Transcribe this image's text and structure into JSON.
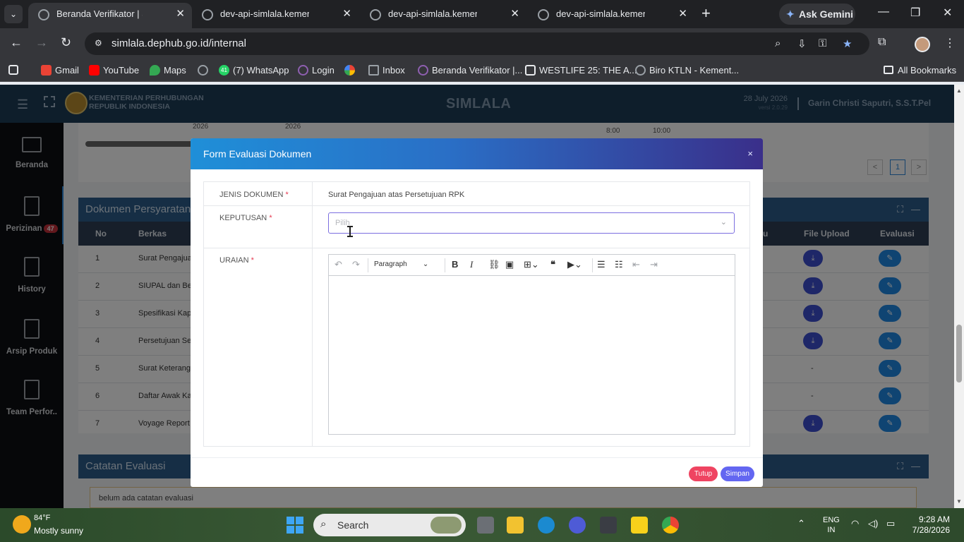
{
  "browser": {
    "tabs": [
      {
        "label": "Beranda Verifikator | SimLala",
        "active": true
      },
      {
        "label": "dev-api-simlala.kemenhub.go.id",
        "active": false
      },
      {
        "label": "dev-api-simlala.kemenhub.go.id",
        "active": false
      },
      {
        "label": "dev-api-simlala.kemenhub.go.id",
        "active": false
      }
    ],
    "gemini_label": "Ask Gemini",
    "url": "simlala.dephub.go.id/internal",
    "bookmarks": [
      {
        "label": "Gmail",
        "color": "#ea4335"
      },
      {
        "label": "YouTube",
        "color": "#ff0000"
      },
      {
        "label": "Maps",
        "color": "#34a853"
      },
      {
        "label": "",
        "color": "#9aa0a6"
      },
      {
        "label": "(7) WhatsApp",
        "color": "#25d366",
        "badge": "41"
      },
      {
        "label": "Login",
        "color": "#8e5fb0"
      },
      {
        "label": "",
        "color": "#fbbc04"
      },
      {
        "label": "Inbox",
        "color": "#9aa0a6"
      },
      {
        "label": "Beranda Verifikator |...",
        "color": "#8e5fb0"
      },
      {
        "label": "WESTLIFE 25: THE A...",
        "color": "#e8eaed"
      },
      {
        "label": "Biro KTLN - Kement...",
        "color": "#9aa0a6"
      }
    ],
    "all_bookmarks": "All Bookmarks"
  },
  "app": {
    "ministry_line1": "KEMENTERIAN PERHUBUNGAN",
    "ministry_line2": "REPUBLIK INDONESIA",
    "title": "SIMLALA",
    "date": "28 July 2026",
    "version": "versi 2.0.29",
    "user": "Garin Christi Saputri, S.S.T.Pel"
  },
  "sidebar": {
    "items": [
      {
        "label": "Beranda",
        "icon": "monitor-icon"
      },
      {
        "label": "Perizinan",
        "icon": "document-icon",
        "badge": "47"
      },
      {
        "label": "History",
        "icon": "document-icon"
      },
      {
        "label": "Arsip Produk",
        "icon": "document-icon"
      },
      {
        "label": "Team Perfor..",
        "icon": "document-icon"
      }
    ]
  },
  "background": {
    "top_dates": [
      "2026",
      "2026"
    ],
    "top_times": [
      "8:00",
      "10:00"
    ],
    "pager_prev": "<",
    "pager_current": "1",
    "pager_next": ">",
    "docs_card_title": "Dokumen Persyaratan",
    "notes_card_title": "Catatan Evaluasi",
    "notes_text": "belum ada catatan evaluasi",
    "columns": {
      "no": "No",
      "berkas": "Berkas",
      "u": "u",
      "file_upload": "File Upload",
      "evaluasi": "Evaluasi"
    },
    "rows": [
      {
        "no": "1",
        "berkas": "Surat Pengajuan",
        "file": "download"
      },
      {
        "no": "2",
        "berkas": "SIUPAL dan Beri",
        "file": "download"
      },
      {
        "no": "3",
        "berkas": "Spesifikasi Kapa",
        "file": "download"
      },
      {
        "no": "4",
        "berkas": "Persetujuan Seb",
        "file": "download"
      },
      {
        "no": "5",
        "berkas": "Surat Keterangan",
        "file": "-"
      },
      {
        "no": "6",
        "berkas": "Daftar Awak Kap",
        "file": "-"
      },
      {
        "no": "7",
        "berkas": "Voyage Report (",
        "file": "download"
      }
    ]
  },
  "modal": {
    "title": "Form Evaluasi Dokumen",
    "close": "×",
    "jenis_label": "JENIS DOKUMEN",
    "jenis_value": "Surat Pengajuan atas Persetujuan RPK",
    "keputusan_label": "KEPUTUSAN",
    "keputusan_placeholder": "Pilih",
    "uraian_label": "URAIAN",
    "required_mark": "*",
    "editor_block_format": "Paragraph",
    "btn_close": "Tutup",
    "btn_save": "Simpan"
  },
  "taskbar": {
    "temperature": "84°F",
    "weather": "Mostly sunny",
    "search_placeholder": "Search",
    "lang_line1": "ENG",
    "lang_line2": "IN",
    "time": "9:28 AM",
    "date": "7/28/2026"
  }
}
